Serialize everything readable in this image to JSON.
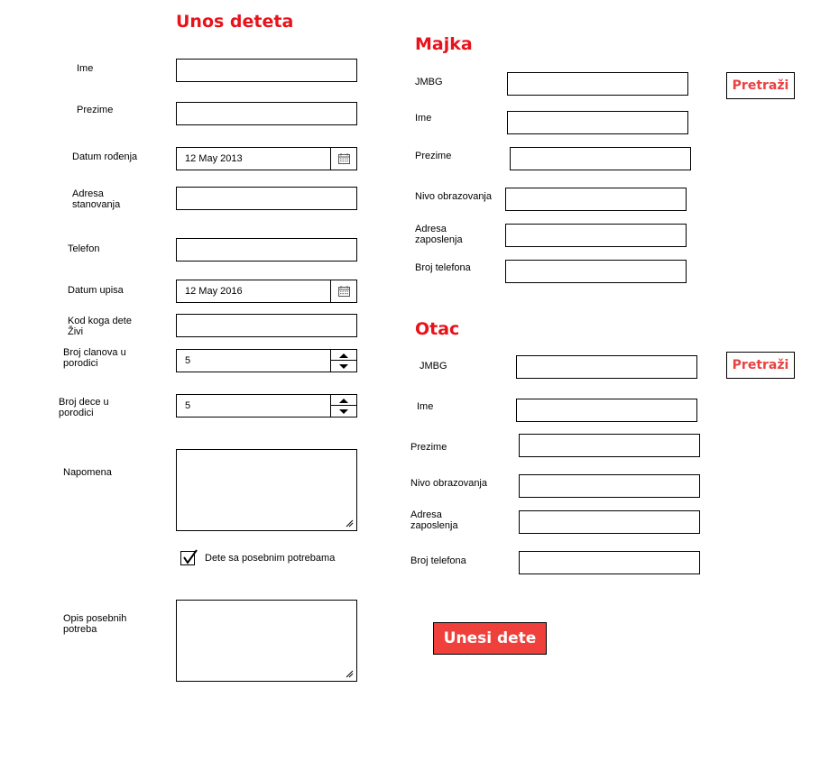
{
  "child": {
    "title": "Unos deteta",
    "ime_label": "Ime",
    "prezime_label": "Prezime",
    "datum_rodjenja_label": "Datum rođenja",
    "datum_rodjenja_value": "12 May 2013",
    "adresa_label_1": "Adresa",
    "adresa_label_2": "stanovanja",
    "telefon_label": "Telefon",
    "datum_upisa_label": "Datum upisa",
    "datum_upisa_value": "12 May 2016",
    "kod_koga_label_1": "Kod koga dete",
    "kod_koga_label_2": "Živi",
    "broj_clanova_label_1": "Broj clanova u",
    "broj_clanova_label_2": "porodici",
    "broj_clanova_value": "5",
    "broj_dece_label_1": "Broj dece u",
    "broj_dece_label_2": "porodici",
    "broj_dece_value": "5",
    "napomena_label": "Napomena",
    "posebne_potrebe_label": "Dete sa posebnim potrebama",
    "posebne_potrebe_checked": true,
    "opis_label_1": "Opis posebnih",
    "opis_label_2": "potreba"
  },
  "mother": {
    "title": "Majka",
    "jmbg_label": "JMBG",
    "search_label": "Pretraži",
    "ime_label": "Ime",
    "prezime_label": "Prezime",
    "nivo_label": "Nivo obrazovanja",
    "adresa_label_1": "Adresa",
    "adresa_label_2": "zaposlenja",
    "telefon_label": "Broj telefona"
  },
  "father": {
    "title": "Otac",
    "jmbg_label": "JMBG",
    "search_label": "Pretraži",
    "ime_label": "Ime",
    "prezime_label": "Prezime",
    "nivo_label": "Nivo obrazovanja",
    "adresa_label_1": "Adresa",
    "adresa_label_2": "zaposlenja",
    "telefon_label": "Broj telefona"
  },
  "submit_label": "Unesi dete",
  "colors": {
    "accent": "#e8121b",
    "button_fill": "#f0403c"
  }
}
